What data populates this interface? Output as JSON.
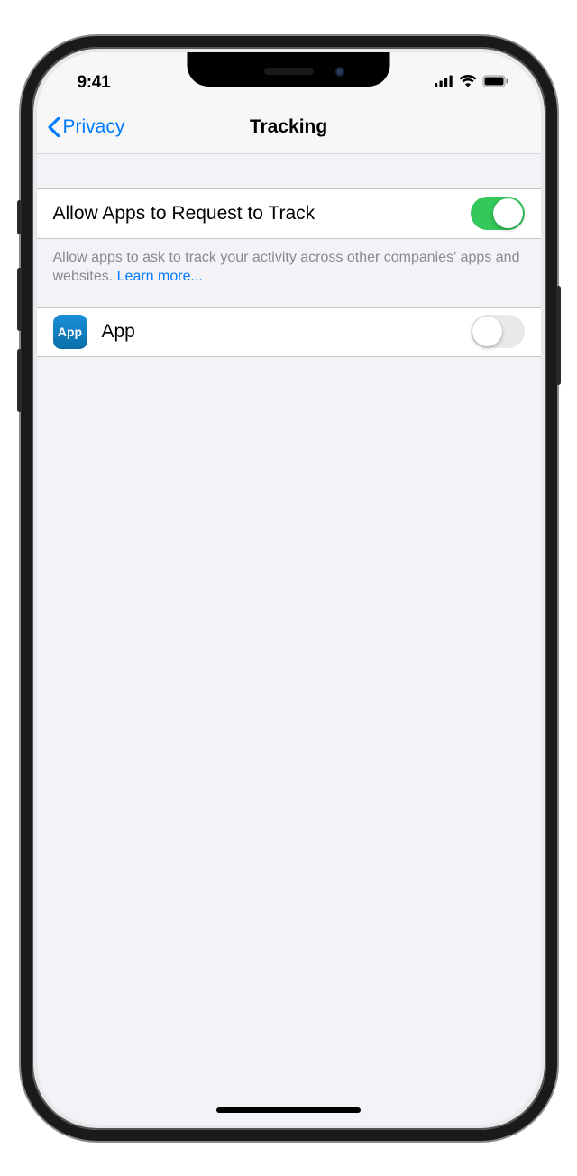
{
  "status": {
    "time": "9:41"
  },
  "nav": {
    "back_label": "Privacy",
    "title": "Tracking"
  },
  "settings": {
    "allow_request": {
      "label": "Allow Apps to Request to Track",
      "on": true
    },
    "description": "Allow apps to ask to track your activity across other companies' apps and websites. ",
    "learn_more": "Learn more...",
    "app": {
      "icon_text": "App",
      "label": "App",
      "on": false
    }
  },
  "colors": {
    "accent": "#007aff",
    "switch_on": "#34c759"
  }
}
